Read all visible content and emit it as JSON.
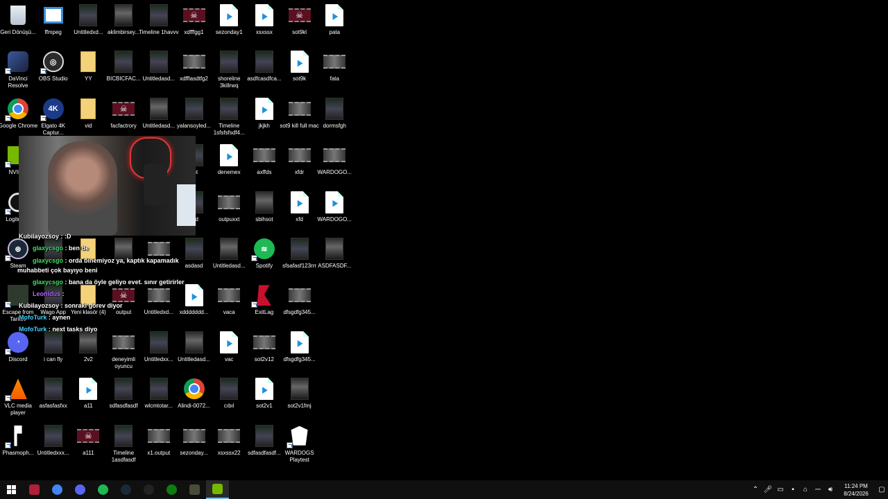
{
  "desktop": {
    "icons": [
      {
        "label": "Geri Dönüşü...",
        "type": "recycle",
        "col": 0,
        "row": 0
      },
      {
        "label": "ffmpeg",
        "type": "ffmpeg",
        "col": 1,
        "row": 0
      },
      {
        "label": "Untitledxd...",
        "type": "video",
        "col": 2,
        "row": 0
      },
      {
        "label": "aklimbirsey...",
        "type": "video",
        "col": 3,
        "row": 0
      },
      {
        "label": "Timeline 1havvv",
        "type": "video",
        "col": 4,
        "row": 0
      },
      {
        "label": "xdfffgg1",
        "type": "skull",
        "col": 5,
        "row": 0
      },
      {
        "label": "sezonday1",
        "type": "media",
        "col": 6,
        "row": 0
      },
      {
        "label": "xsxssx",
        "type": "media",
        "col": 7,
        "row": 0
      },
      {
        "label": "sot9kl",
        "type": "skull",
        "col": 8,
        "row": 0
      },
      {
        "label": "pata",
        "type": "media",
        "col": 9,
        "row": 0
      },
      {
        "label": "DaVinci Resolve",
        "type": "davinci",
        "col": 0,
        "row": 1,
        "shortcut": true
      },
      {
        "label": "OBS Studio",
        "type": "obs",
        "col": 1,
        "row": 1,
        "shortcut": true
      },
      {
        "label": "YY",
        "type": "folder",
        "col": 2,
        "row": 1
      },
      {
        "label": "BICBICFAC...",
        "type": "video",
        "col": 3,
        "row": 1
      },
      {
        "label": "Untitledasd...",
        "type": "video",
        "col": 4,
        "row": 1
      },
      {
        "label": "xdfflasdtfg2",
        "type": "film",
        "col": 5,
        "row": 1
      },
      {
        "label": "shoreline 3killrwq",
        "type": "video",
        "col": 6,
        "row": 1
      },
      {
        "label": "asdfcasdfca...",
        "type": "video",
        "col": 7,
        "row": 1
      },
      {
        "label": "sot9k",
        "type": "media",
        "col": 8,
        "row": 1
      },
      {
        "label": "fata",
        "type": "film",
        "col": 9,
        "row": 1
      },
      {
        "label": "Google Chrome",
        "type": "chrome",
        "col": 0,
        "row": 2,
        "shortcut": true
      },
      {
        "label": "Elgato 4K Captur...",
        "type": "elgato",
        "col": 1,
        "row": 2,
        "shortcut": true
      },
      {
        "label": "vid",
        "type": "folder",
        "col": 2,
        "row": 2
      },
      {
        "label": "facfactrory",
        "type": "skull",
        "col": 3,
        "row": 2
      },
      {
        "label": "Untitledasd...",
        "type": "video",
        "col": 4,
        "row": 2
      },
      {
        "label": "yalansoyled...",
        "type": "video",
        "col": 5,
        "row": 2
      },
      {
        "label": "Timeline 1sfsfsfsdf4...",
        "type": "video",
        "col": 6,
        "row": 2
      },
      {
        "label": "jkjkh",
        "type": "media",
        "col": 7,
        "row": 2
      },
      {
        "label": "sot9 kill full mac",
        "type": "film",
        "col": 8,
        "row": 2
      },
      {
        "label": "dormsfgh",
        "type": "video",
        "col": 9,
        "row": 2
      },
      {
        "label": "NVIDIA",
        "type": "nvidia",
        "col": 0,
        "row": 3,
        "shortcut": true
      },
      {
        "label": "ght",
        "type": "video",
        "col": 5,
        "row": 3
      },
      {
        "label": "denemex",
        "type": "media",
        "col": 6,
        "row": 3
      },
      {
        "label": "axffds",
        "type": "film",
        "col": 7,
        "row": 3
      },
      {
        "label": "xfdr",
        "type": "film",
        "col": 8,
        "row": 3
      },
      {
        "label": "WARDOGO...",
        "type": "film",
        "col": 9,
        "row": 3
      },
      {
        "label": "Logite HU",
        "type": "logi",
        "col": 0,
        "row": 4,
        "shortcut": true
      },
      {
        "label": "asd",
        "type": "video",
        "col": 5,
        "row": 4
      },
      {
        "label": "outpuxxt",
        "type": "film",
        "col": 6,
        "row": 4
      },
      {
        "label": "sbihsot",
        "type": "video",
        "col": 7,
        "row": 4
      },
      {
        "label": "xfd",
        "type": "media",
        "col": 8,
        "row": 4
      },
      {
        "label": "WARDOGO...",
        "type": "media",
        "col": 9,
        "row": 4
      },
      {
        "label": "Steam",
        "type": "steam",
        "col": 0,
        "row": 5,
        "shortcut": true
      },
      {
        "label": "",
        "type": "video",
        "col": 1,
        "row": 5
      },
      {
        "label": "",
        "type": "folder",
        "col": 2,
        "row": 5
      },
      {
        "label": "",
        "type": "video",
        "col": 3,
        "row": 5
      },
      {
        "label": "",
        "type": "film",
        "col": 4,
        "row": 5
      },
      {
        "label": "asdasd",
        "type": "video",
        "col": 5,
        "row": 5
      },
      {
        "label": "Untitledasd...",
        "type": "video",
        "col": 6,
        "row": 5
      },
      {
        "label": "Spotify",
        "type": "spotify",
        "col": 7,
        "row": 5,
        "shortcut": true
      },
      {
        "label": "sfsafasf123rrr",
        "type": "video",
        "col": 8,
        "row": 5
      },
      {
        "label": "ASDFASDF...",
        "type": "video",
        "col": 9,
        "row": 5
      },
      {
        "label": "Escape from Tarkov",
        "type": "tarkov",
        "col": 0,
        "row": 6,
        "shortcut": true
      },
      {
        "label": "Wago App",
        "type": "video",
        "col": 1,
        "row": 6
      },
      {
        "label": "Yeni klasör (4)",
        "type": "folder",
        "col": 2,
        "row": 6
      },
      {
        "label": "output",
        "type": "skull",
        "col": 3,
        "row": 6
      },
      {
        "label": "Untitledxd...",
        "type": "film",
        "col": 4,
        "row": 6
      },
      {
        "label": "xddddddd...",
        "type": "media",
        "col": 5,
        "row": 6
      },
      {
        "label": "vaca",
        "type": "film",
        "col": 6,
        "row": 6
      },
      {
        "label": "ExitLag",
        "type": "exitlag",
        "col": 7,
        "row": 6,
        "shortcut": true
      },
      {
        "label": "dfsgdfg345...",
        "type": "film",
        "col": 8,
        "row": 6
      },
      {
        "label": "Discord",
        "type": "discord",
        "col": 0,
        "row": 7,
        "shortcut": true
      },
      {
        "label": "i can fly",
        "type": "video",
        "col": 1,
        "row": 7
      },
      {
        "label": "2v2",
        "type": "video",
        "col": 2,
        "row": 7
      },
      {
        "label": "deneyimli oyuncu",
        "type": "film",
        "col": 3,
        "row": 7
      },
      {
        "label": "Untitledxx...",
        "type": "video",
        "col": 4,
        "row": 7
      },
      {
        "label": "Untitledasd...",
        "type": "video",
        "col": 5,
        "row": 7
      },
      {
        "label": "vac",
        "type": "media",
        "col": 6,
        "row": 7
      },
      {
        "label": "sot2v12",
        "type": "film",
        "col": 7,
        "row": 7
      },
      {
        "label": "dfsgdfg345...",
        "type": "media",
        "col": 8,
        "row": 7
      },
      {
        "label": "VLC media player",
        "type": "vlc",
        "col": 0,
        "row": 8,
        "shortcut": true
      },
      {
        "label": "asfasfasfxx",
        "type": "video",
        "col": 1,
        "row": 8
      },
      {
        "label": "a11",
        "type": "media",
        "col": 2,
        "row": 8
      },
      {
        "label": "sdfasdfasdf",
        "type": "video",
        "col": 3,
        "row": 8
      },
      {
        "label": "wlcmtotar...",
        "type": "video",
        "col": 4,
        "row": 8
      },
      {
        "label": "Alindi-0072...",
        "type": "chrome",
        "col": 5,
        "row": 8
      },
      {
        "label": "cıbıl",
        "type": "video",
        "col": 6,
        "row": 8
      },
      {
        "label": "sot2v1",
        "type": "media",
        "col": 7,
        "row": 8
      },
      {
        "label": "sot2v1fmj",
        "type": "video",
        "col": 8,
        "row": 8
      },
      {
        "label": "Phasmoph...",
        "type": "phasmo",
        "col": 0,
        "row": 9,
        "shortcut": true
      },
      {
        "label": "Untitledxxx...",
        "type": "video",
        "col": 1,
        "row": 9
      },
      {
        "label": "a111",
        "type": "skull",
        "col": 2,
        "row": 9
      },
      {
        "label": "Timeline 1asdfasdf",
        "type": "video",
        "col": 3,
        "row": 9
      },
      {
        "label": "x1.output",
        "type": "film",
        "col": 4,
        "row": 9
      },
      {
        "label": "sezonday...",
        "type": "film",
        "col": 5,
        "row": 9
      },
      {
        "label": "xsxssx22",
        "type": "film",
        "col": 6,
        "row": 9
      },
      {
        "label": "sdfasdfasdf...",
        "type": "video",
        "col": 7,
        "row": 9
      },
      {
        "label": "WARDOGS Playtest",
        "type": "wardogs",
        "col": 8,
        "row": 9,
        "shortcut": true
      }
    ]
  },
  "chat": {
    "messages": [
      {
        "user": "Kubilayozsoy",
        "text": " : :D",
        "color": "#ffffff"
      },
      {
        "user": "glaxycsgo",
        "text": " : ben de",
        "color": "#44e064"
      },
      {
        "user": "glaxycsgo",
        "text": " : orda binemiyoz ya, kaptık kapamadık",
        "color": "#44e064"
      },
      {
        "user": "",
        "text": "muhabbeti çok bayıyo beni",
        "color": "#ffffff"
      },
      {
        "user": "glaxycsgo",
        "text": " : bana da öyle geliyo evet. sınır getirirler",
        "color": "#44e064"
      },
      {
        "user": "Leonidus",
        "text": " : ",
        "color": "#b46cff"
      },
      {
        "user": "Kubilayozsoy",
        "text": " : sonraki görev diyor",
        "color": "#ffffff"
      },
      {
        "user": "MofoTurk",
        "text": " : aynen",
        "color": "#44d0ff"
      },
      {
        "user": "MofoTurk",
        "text": " : next tasks diyo",
        "color": "#44d0ff"
      }
    ]
  },
  "taskbar": {
    "apps": [
      {
        "name": "Voicemeeter",
        "icon": "voicemeeter-icon",
        "color": "#b0203a"
      },
      {
        "name": "Google Chrome",
        "icon": "chrome-icon",
        "color": "#4285f4"
      },
      {
        "name": "Discord Ptb",
        "icon": "discord-icon",
        "color": "#5865f2"
      },
      {
        "name": "Spotify",
        "icon": "spotify-icon",
        "color": "#1db954"
      },
      {
        "name": "Steam",
        "icon": "steam-icon",
        "color": "#1b2838"
      },
      {
        "name": "Logitech G HUB",
        "icon": "ghub-icon",
        "color": "#222222"
      },
      {
        "name": "Xbox",
        "icon": "xbox-icon",
        "color": "#107c10"
      },
      {
        "name": "Escape from Tarkov",
        "icon": "tarkov-icon",
        "color": "#4a4a3a"
      },
      {
        "name": "NVIDIA",
        "icon": "nvidia-icon",
        "color": "#76b900",
        "active": true
      }
    ],
    "clock": {
      "time": "11:24 PM",
      "date": "8/24/2026"
    }
  }
}
